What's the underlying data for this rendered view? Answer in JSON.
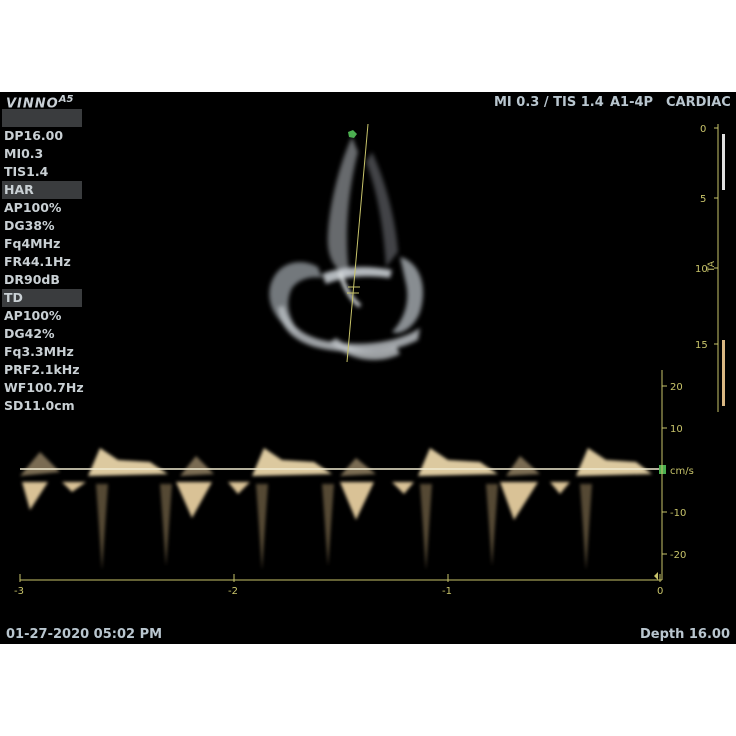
{
  "brand": {
    "name": "VINNO",
    "model": "A5"
  },
  "header": {
    "mi_tis": "MI 0.3 / TIS 1.4",
    "probe": "A1-4P",
    "preset": "CARDIAC"
  },
  "params": [
    {
      "label": "",
      "highlight": true
    },
    {
      "label": "DP16.00",
      "highlight": false
    },
    {
      "label": "MI0.3",
      "highlight": false
    },
    {
      "label": "TIS1.4",
      "highlight": false
    },
    {
      "label": "HAR",
      "highlight": true
    },
    {
      "label": "AP100%",
      "highlight": false
    },
    {
      "label": "DG38%",
      "highlight": false
    },
    {
      "label": "Fq4MHz",
      "highlight": false
    },
    {
      "label": "FR44.1Hz",
      "highlight": false
    },
    {
      "label": "DR90dB",
      "highlight": false
    },
    {
      "label": "TD",
      "highlight": true
    },
    {
      "label": "AP100%",
      "highlight": false
    },
    {
      "label": "DG42%",
      "highlight": false
    },
    {
      "label": "Fq3.3MHz",
      "highlight": false
    },
    {
      "label": "PRF2.1kHz",
      "highlight": false
    },
    {
      "label": "WF100.7Hz",
      "highlight": false
    },
    {
      "label": "SD11.0cm",
      "highlight": false
    }
  ],
  "depth_scale": {
    "ticks": [
      "0",
      "5",
      "10",
      "15"
    ],
    "label": "TA"
  },
  "velocity_scale": {
    "ticks": [
      "20",
      "10",
      "-10",
      "-20"
    ],
    "unit": "cm/s"
  },
  "time_axis": {
    "ticks": [
      "-3",
      "-2",
      "-1",
      "0"
    ]
  },
  "footer": {
    "datetime": "01-27-2020 05:02 PM",
    "depth": "Depth 16.00"
  },
  "colors": {
    "accent": "#c8c46a",
    "text": "#c9d0d4",
    "doppler": "#e8d4a8",
    "marker": "#4caf50"
  }
}
